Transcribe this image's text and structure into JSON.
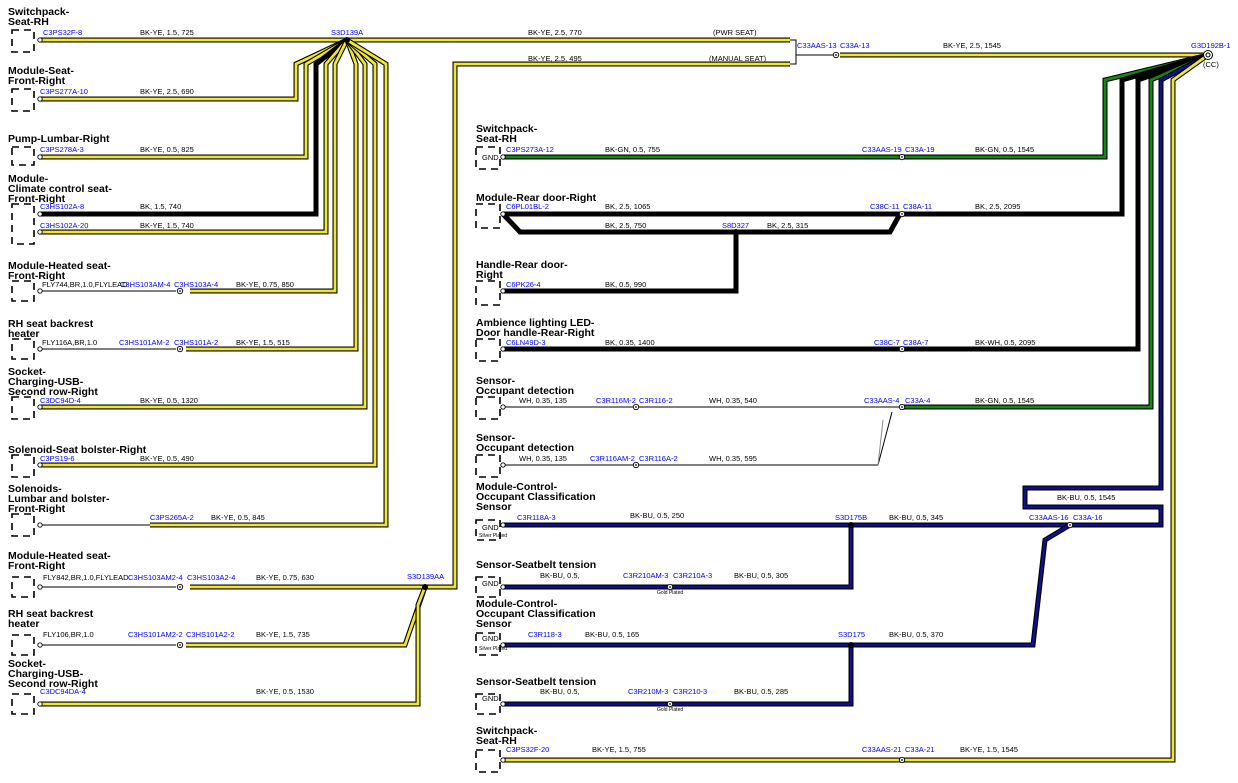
{
  "colors": {
    "BK": "#000000",
    "YE": "#f0e630",
    "GN": "#138813",
    "BU": "#10108a",
    "WH": "#ffffff",
    "conn": "#0000ff"
  },
  "titles": {
    "t1": [
      "Switchpack-",
      "Seat-RH"
    ],
    "t2": [
      "Module-Seat-",
      "Front-Right"
    ],
    "t3": [
      "Pump-Lumbar-Right"
    ],
    "t4": [
      "Module-",
      "Climate control seat-",
      "Front-Right"
    ],
    "t5": [
      "Module-Heated seat-",
      "Front-Right"
    ],
    "t6": [
      "RH seat backrest",
      "heater"
    ],
    "t7": [
      "Socket-",
      "Charging-USB-",
      "Second row-Right"
    ],
    "t8": [
      "Solenoid-Seat bolster-Right"
    ],
    "t9": [
      "Solenoids-",
      "Lumbar and bolster-",
      "Front-Right"
    ],
    "t10": [
      "Module-Heated seat-",
      "Front-Right"
    ],
    "t11": [
      "RH seat backrest",
      "heater"
    ],
    "t12": [
      "Socket-",
      "Charging-USB-",
      "Second row-Right"
    ],
    "r1": [
      "Switchpack-",
      "Seat-RH"
    ],
    "r2": [
      "Module-Rear door-Right"
    ],
    "r3": [
      "Handle-Rear door-",
      "Right"
    ],
    "r4": [
      "Ambience lighting LED-",
      "Door handle-Rear-Right"
    ],
    "r5": [
      "Sensor-",
      "Occupant detection"
    ],
    "r6": [
      "Sensor-",
      "Occupant detection"
    ],
    "r7": [
      "Module-Control-",
      "Occupant Classification",
      "Sensor"
    ],
    "r8": [
      "Sensor-Seatbelt tension"
    ],
    "r9": [
      "Module-Control-",
      "Occupant Classification",
      "Sensor"
    ],
    "r10": [
      "Sensor-Seatbelt tension"
    ],
    "r11": [
      "Switchpack-",
      "Seat-RH"
    ]
  },
  "connectors": {
    "c1": "C3PS32F-8",
    "c2": "C3PS277A-10",
    "c3": "C3PS278A-3",
    "c4": "C3HS102A-8",
    "c5": "C3HS102A-20",
    "c6a": "C3HS103AM-4",
    "c6b": "C3HS103A-4",
    "c7a": "C3HS101AM-2",
    "c7b": "C3HS101A-2",
    "c8": "C3DC94D-4",
    "c9": "C3PS19-6",
    "c10": "C3PS265A-2",
    "c11a": "C3HS103AM2-4",
    "c11b": "C3HS103A2-4",
    "c12a": "C3HS101AM2-2",
    "c12b": "C3HS101A2-2",
    "c13": "C3DC94DA-4",
    "splice1": "S3D139A",
    "splice2": "S3D139AA",
    "c33a": "C33AAS-13",
    "c33b": "C33A-13",
    "g3": "G3D192B-1",
    "r1": "C3PS273A-12",
    "r1a": "C33AAS-19",
    "r1b": "C33A-19",
    "r2": "C6PL01BL-2",
    "r2a": "C38C-11",
    "r2b": "C38A-11",
    "s8d": "S8D327",
    "r3": "C6PK26-4",
    "r4": "C6LN49D-3",
    "r4a": "C38C-7",
    "r4b": "C38A-7",
    "r5a": "C3R116M-2",
    "r5b": "C3R116-2",
    "r5c": "C33AAS-4",
    "r5d": "C33A-4",
    "r6a": "C3R116AM-2",
    "r6b": "C3R116A-2",
    "r7": "C3R118A-3",
    "s3d175b": "S3D175B",
    "r7a": "C33AAS-16",
    "r7b": "C33A-16",
    "r8a": "C3R210AM-3",
    "r8b": "C3R210A-3",
    "r9": "C3R118-3",
    "s3d175": "S3D175",
    "r10a": "C3R210M-3",
    "r10b": "C3R210-3",
    "r11": "C3PS32F-20",
    "r11a": "C33AAS-21",
    "r11b": "C33A-21"
  },
  "wires": {
    "w1": "BK-YE,  1.5,  725",
    "w2": "BK-YE,  2.5,  770",
    "w3": "BK-YE,  2.5,  495",
    "w4": "BK-YE,  2.5,  1545",
    "w5": "BK-YE,  2.5,  690",
    "w6": "BK-YE,  0.5,  825",
    "w7": "BK,  1.5,  740",
    "w8": "BK-YE,  1.5,  740",
    "w9fly": "FLY744,BR,1.0,FLYLEAD",
    "w9": "BK-YE,  0.75,  850",
    "w10fly": "FLY116A,BR,1.0",
    "w10": "BK-YE,  1.5,  515",
    "w11": "BK-YE,  0.5,  1320",
    "w12": "BK-YE,  0.5,  490",
    "w13": "BK-YE,  0.5,  845",
    "w14fly": "FLY842,BR,1.0,FLYLEAD",
    "w14": "BK-YE,  0.75,  630",
    "w15fly": "FLY106,BR,1.0",
    "w15": "BK-YE,  1.5,  735",
    "w16": "BK-YE,  0.5,  1530",
    "rw1": "BK-GN,  0.5,  755",
    "rw1b": "BK-GN,  0.5,  1545",
    "rw2": "BK,  2.5,  1065",
    "rw2b": "BK,  2.5,  2095",
    "rw2c": "BK,  2.5,  750",
    "rw2d": "BK,  2.5,  315",
    "rw3": "BK,  0.5,  990",
    "rw4": "BK,  0.35,  1400",
    "rw4b": "BK-WH,  0.5,  2095",
    "rw5": "WH,  0.35,  135",
    "rw5b": "WH,  0.35,  540",
    "rw5c": "BK-GN,  0.5,  1545",
    "rw6": "WH,  0.35,  135",
    "rw6b": "WH,  0.35,  595",
    "rw7": "BK-BU,  0.5,  250",
    "rw7b": "BK-BU,  0.5,  345",
    "rw7c": "BK-BU,  0.5,  1545",
    "rw8": "BK-BU,  0.5,",
    "rw8b": "BK-BU,  0.5,  305",
    "rw9": "BK-BU,  0.5,  165",
    "rw9b": "BK-BU,  0.5,  370",
    "rw10": "BK-BU,  0.5,",
    "rw10b": "BK-BU,  0.5,  285",
    "rw11": "BK-YE,  1.5,  755",
    "rw11b": "BK-YE,  1.5,  1545"
  },
  "notes": {
    "pwr": "(PWR SEAT)",
    "manual": "(MANUAL SEAT)",
    "cc": "(CC)",
    "gnd": "GND",
    "silver": "Silver Plated",
    "gold": "Gold Plated"
  }
}
